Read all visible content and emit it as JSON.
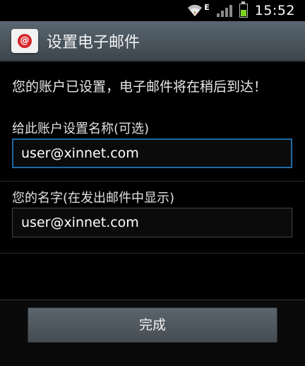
{
  "status_bar": {
    "time": "15:52",
    "network_type": "E",
    "icons": [
      "wifi-icon",
      "signal-icon",
      "battery-icon"
    ],
    "battery_color": "#7ed321"
  },
  "header": {
    "title": "设置电子邮件",
    "app_icon": "email-app-icon"
  },
  "main": {
    "info_text": "您的账户已设置，电子邮件将在稍后到达！",
    "account_name": {
      "label": "给此账户设置名称(可选)",
      "value": "user@xinnet.com"
    },
    "your_name": {
      "label": "您的名字(在发出邮件中显示)",
      "value": "user@xinnet.com"
    }
  },
  "footer": {
    "done_label": "完成"
  },
  "colors": {
    "focus_border": "#1f6aa5",
    "email_icon_red": "#d7262b"
  }
}
